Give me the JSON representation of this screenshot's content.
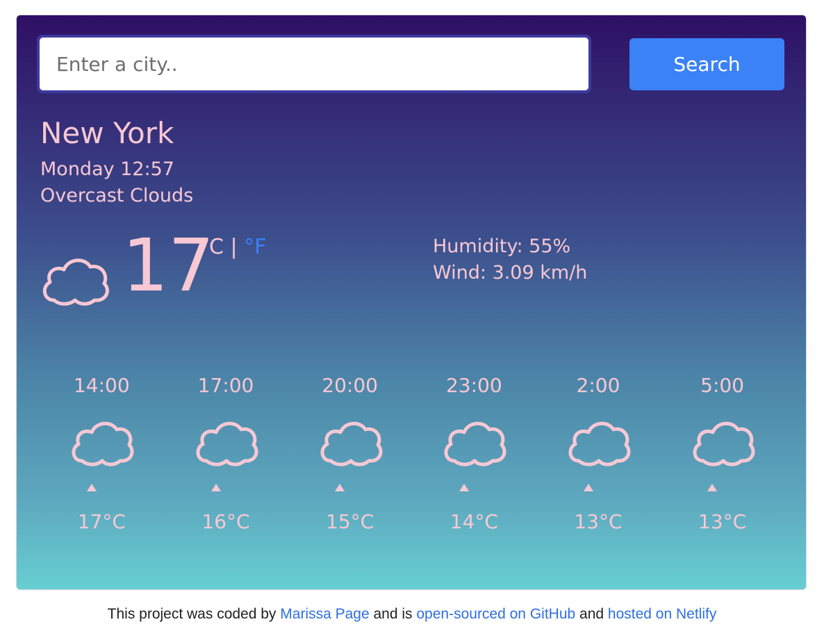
{
  "search": {
    "placeholder": "Enter a city..",
    "button_label": "Search"
  },
  "current": {
    "city": "New York",
    "datetime": "Monday 12:57",
    "description": "Overcast Clouds",
    "temperature": "17",
    "unit_c": "°C",
    "unit_sep": " | ",
    "unit_f": "°F",
    "humidity": "Humidity: 55%",
    "wind": "Wind: 3.09 km/h",
    "icon": "cloud-icon"
  },
  "forecast": [
    {
      "time": "14:00",
      "temp": "17°C",
      "icon": "cloud-icon"
    },
    {
      "time": "17:00",
      "temp": "16°C",
      "icon": "cloud-icon"
    },
    {
      "time": "20:00",
      "temp": "15°C",
      "icon": "cloud-icon"
    },
    {
      "time": "23:00",
      "temp": "14°C",
      "icon": "cloud-icon"
    },
    {
      "time": "2:00",
      "temp": "13°C",
      "icon": "cloud-icon"
    },
    {
      "time": "5:00",
      "temp": "13°C",
      "icon": "cloud-icon"
    }
  ],
  "footer": {
    "text_1": "This project was coded by ",
    "link_author": "Marissa Page",
    "text_2": " and is ",
    "link_github": "open-sourced on GitHub",
    "text_3": " and ",
    "link_netlify": "hosted on Netlify"
  },
  "colors": {
    "accent": "#3b82f6",
    "text_pink": "#f8c8d4",
    "gradient_top": "#2e1065",
    "gradient_bottom": "#67cfd2"
  }
}
